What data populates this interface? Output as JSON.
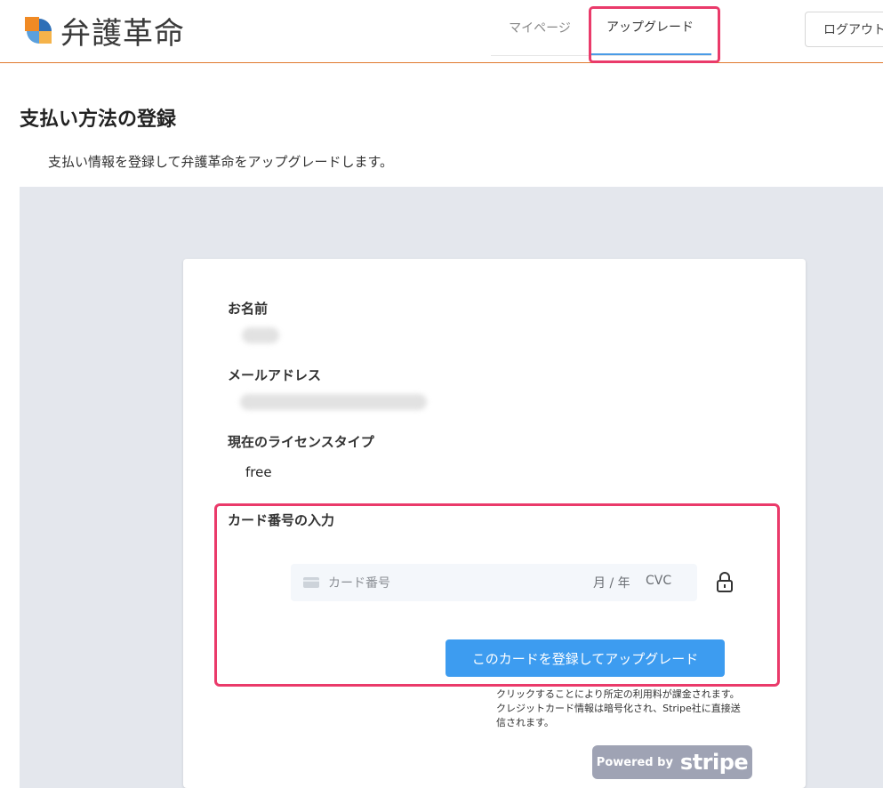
{
  "header": {
    "logo_text": "弁護革命",
    "nav": [
      {
        "label": "マイページ"
      },
      {
        "label": "アップグレード"
      }
    ],
    "logout_label": "ログアウト"
  },
  "page": {
    "title": "支払い方法の登録",
    "description": "支払い情報を登録して弁護革命をアップグレードします。"
  },
  "form": {
    "name_label": "お名前",
    "email_label": "メールアドレス",
    "license_label": "現在のライセンスタイプ",
    "license_value": "free",
    "card_section_label": "カード番号の入力",
    "card_number_placeholder": "カード番号",
    "expiry_placeholder": "月 / 年",
    "cvc_placeholder": "CVC",
    "submit_label": "このカードを登録してアップグレード",
    "notice_text": "クリックすることにより所定の利用料が課金されます。クレジットカード情報は暗号化され、Stripe社に直接送信されます。",
    "stripe_badge_prefix": "Powered by",
    "stripe_badge_word": "stripe"
  },
  "colors": {
    "accent_orange": "#e07a2f",
    "highlight_pink": "#ea3a6a",
    "button_blue": "#3d9cf0",
    "panel_grey": "#e4e7ed"
  }
}
